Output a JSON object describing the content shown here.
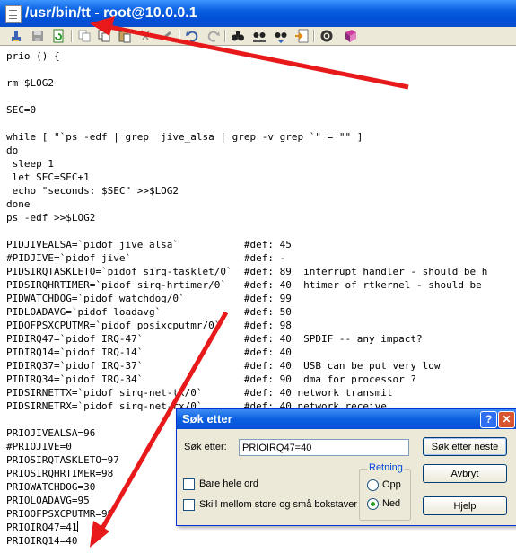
{
  "window": {
    "title": "/usr/bin/tt - root@10.0.0.1"
  },
  "toolbar": {
    "icons": [
      "exit-icon",
      "save-icon",
      "refresh-icon",
      "copy-icon",
      "paste-icon",
      "cut-icon",
      "delete-icon",
      "undo-icon",
      "redo-icon",
      "find-icon",
      "find-replace-icon",
      "find-next-icon",
      "goto-icon",
      "settings-icon",
      "help-book-icon"
    ]
  },
  "editor": {
    "lines": [
      "prio () {",
      "",
      "rm $LOG2",
      "",
      "SEC=0",
      "",
      "while [ \"`ps -edf | grep  jive_alsa | grep -v grep `\" = \"\" ]",
      "do",
      " sleep 1",
      " let SEC=SEC+1",
      " echo \"seconds: $SEC\" >>$LOG2",
      "done",
      "ps -edf >>$LOG2",
      "",
      "PIDJIVEALSA=`pidof jive_alsa`           #def: 45",
      "#PIDJIVE=`pidof jive`                   #def: -",
      "PIDSIRQTASKLETO=`pidof sirq-tasklet/0`  #def: 89  interrupt handler - should be h",
      "PIDSIRQHRTIMER=`pidof sirq-hrtimer/0`   #def: 40  htimer of rtkernel - should be",
      "PIDWATCHDOG=`pidof watchdog/0`          #def: 99",
      "PIDLOADAVG=`pidof loadavg`              #def: 50",
      "PIDOFPSXCPUTMR=`pidof posixcputmr/0`    #def: 98",
      "PIDIRQ47=`pidof IRQ-47`                 #def: 40  SPDIF -- any impact?",
      "PIDIRQ14=`pidof IRQ-14`                 #def: 40",
      "PIDIRQ37=`pidof IRQ-37`                 #def: 40  USB can be put very low",
      "PIDIRQ34=`pidof IRQ-34`                 #def: 90  dma for processor ?",
      "PIDSIRNETTX=`pidof sirq-net-tx/0`       #def: 40 network transmit",
      "PIDSIRNETRX=`pidof sirq-net-rx/0`       #def: 40 network receive",
      "",
      "PRIOJIVEALSA=96",
      "#PRIOJIVE=0",
      "PRIOSIRQTASKLETO=97",
      "PRIOSIRQHRTIMER=98",
      "PRIOWATCHDOG=30",
      "PRIOLOADAVG=95",
      "PRIOOFPSXCPUTMR=99",
      "PRIOIRQ47=41",
      "PRIOIRQ14=40"
    ]
  },
  "dialog": {
    "title": "Søk etter",
    "search_label": "Søk etter:",
    "search_value": "PRIOIRQ47=40",
    "find_next": "Søk etter neste",
    "cancel": "Avbryt",
    "help": "Hjelp",
    "whole_word": "Bare hele ord",
    "match_case": "Skill mellom store og små bokstaver",
    "direction_label": "Retning",
    "up": "Opp",
    "down": "Ned",
    "help_btn": "?",
    "close_btn": "✕"
  },
  "colors": {
    "title_blue": "#0a5fe0",
    "dialog_bg": "#ece9d8",
    "arrow_red": "#e8191a"
  }
}
